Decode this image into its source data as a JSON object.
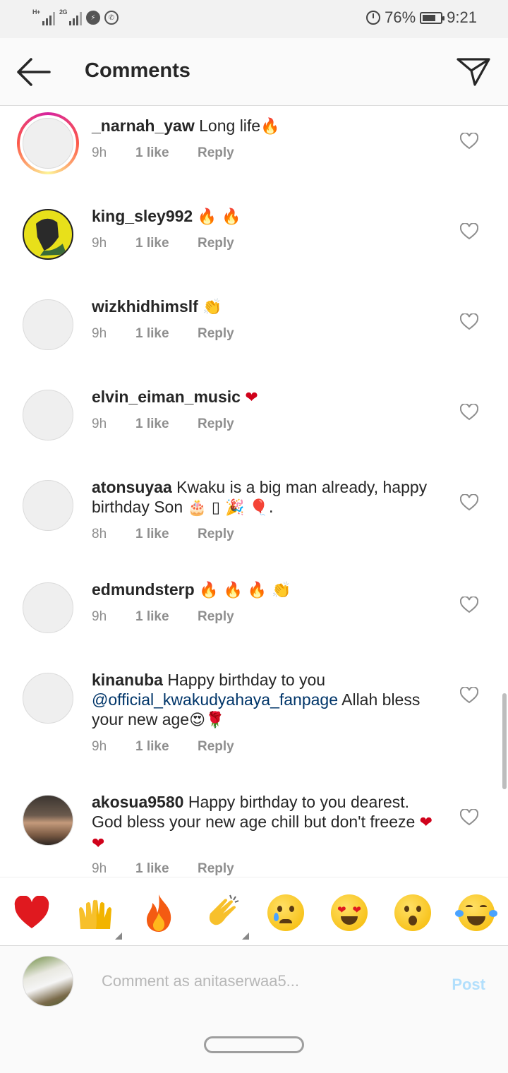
{
  "status_bar": {
    "network1": "H+",
    "network2": "2G",
    "battery": "76%",
    "time": "9:21",
    "icons": [
      "signal-icon",
      "signal-icon",
      "messenger-icon",
      "whatsapp-icon",
      "alarm-icon",
      "battery-icon"
    ]
  },
  "header": {
    "title": "Comments",
    "back_icon": "arrow-left-icon",
    "send_icon": "paper-plane-icon"
  },
  "comments": [
    {
      "username": "_narnah_yaw",
      "text": " Long life",
      "emoji": "🔥",
      "time": "9h",
      "likes": "1 like",
      "reply": "Reply"
    },
    {
      "username": "king_sley992",
      "text": " ",
      "emoji": "🔥 🔥",
      "time": "9h",
      "likes": "1 like",
      "reply": "Reply"
    },
    {
      "username": "wizkhidhimslf",
      "text": " ",
      "emoji": "👏",
      "time": "9h",
      "likes": "1 like",
      "reply": "Reply"
    },
    {
      "username": "elvin_eiman_music",
      "text": " ",
      "emoji": "❤",
      "time": "9h",
      "likes": "1 like",
      "reply": "Reply"
    },
    {
      "username": "atonsuyaa",
      "text": " Kwaku is a big man already,  happy birthday Son ",
      "emoji": "🎂 ▯ 🎉 🎈.",
      "time": "8h",
      "likes": "1 like",
      "reply": "Reply"
    },
    {
      "username": "edmundsterp",
      "text": " ",
      "emoji": "🔥 🔥 🔥 👏",
      "time": "9h",
      "likes": "1 like",
      "reply": "Reply"
    },
    {
      "username": "kinanuba",
      "text_before": " Happy birthday to you ",
      "mention": "@official_kwakudyahaya_fanpage",
      "text_after": " Allah bless your new age",
      "emoji": "😍🌹",
      "time": "9h",
      "likes": "1 like",
      "reply": "Reply"
    },
    {
      "username": "akosua9580",
      "text": " Happy birthday to you dearest. God bless your new age chill but don't freeze ",
      "emoji": "❤❤",
      "time": "9h",
      "likes": "1 like",
      "reply": "Reply"
    }
  ],
  "reactions": [
    "red-heart",
    "raising-hands",
    "fire",
    "clapping-hands",
    "crying-face",
    "heart-eyes-face",
    "surprised-face",
    "tears-of-joy-face"
  ],
  "composer": {
    "placeholder": "Comment as anitaserwaa5...",
    "post_label": "Post"
  },
  "colors": {
    "accent_disabled": "#b2dffc",
    "mention": "#003569",
    "meta_gray": "#8e8e8e"
  }
}
